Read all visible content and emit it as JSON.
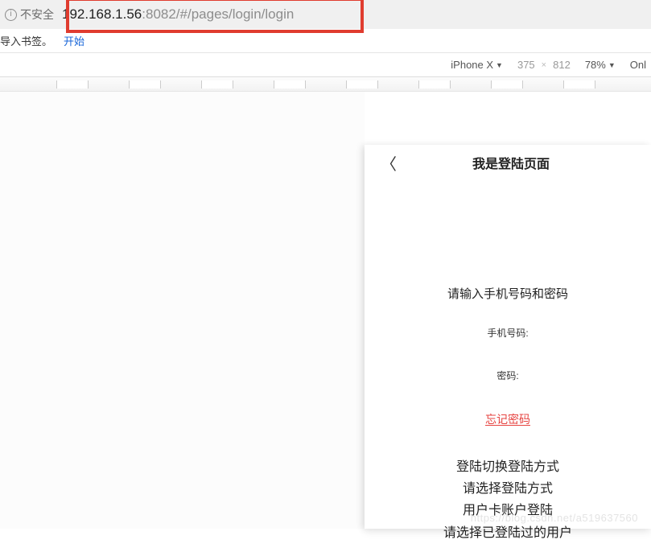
{
  "browser": {
    "not_safe_label": "不安全",
    "url_host": "192.168.1.56",
    "url_port_path": ":8082/#/pages/login/login"
  },
  "bookmark_bar": {
    "import_text": "导入书签。",
    "start_link": "开始"
  },
  "devtools": {
    "device_name": "iPhone X",
    "width": "375",
    "height": "812",
    "zoom": "78%",
    "throttle": "Onl"
  },
  "mobile": {
    "title": "我是登陆页面",
    "prompt": "请输入手机号码和密码",
    "phone_label": "手机号码:",
    "password_label": "密码:",
    "forgot": "忘记密码",
    "options": [
      "登陆切换登陆方式",
      "请选择登陆方式",
      "用户卡账户登陆",
      "请选择已登陆过的用户"
    ]
  },
  "watermark": "https://blog.csdn.net/a519637560"
}
